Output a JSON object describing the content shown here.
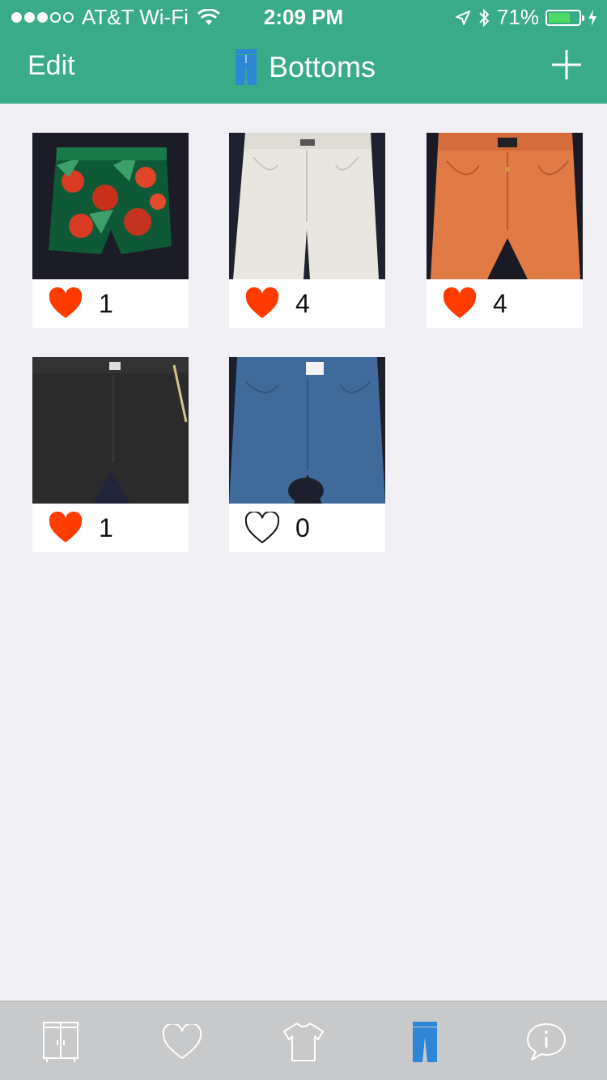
{
  "status_bar": {
    "carrier": "AT&T Wi-Fi",
    "time": "2:09 PM",
    "battery": "71%",
    "battery_level": 0.71,
    "signal_bars_filled": 3,
    "signal_bars_total": 5
  },
  "nav": {
    "edit_label": "Edit",
    "title": "Bottoms",
    "add_icon": "plus-icon",
    "title_icon": "pants-icon"
  },
  "colors": {
    "header": "#3aab88",
    "heart": "#ff3b00",
    "tab_active": "#2e86d6",
    "background": "#efeff4",
    "tabbar": "#c8c9cb"
  },
  "items": [
    {
      "name": "floral shorts",
      "likes": "1",
      "liked": true
    },
    {
      "name": "white jeans",
      "likes": "4",
      "liked": true
    },
    {
      "name": "orange jeans",
      "likes": "4",
      "liked": true
    },
    {
      "name": "black pants",
      "likes": "1",
      "liked": true
    },
    {
      "name": "blue jeggings",
      "likes": "0",
      "liked": false
    }
  ],
  "tabs": [
    {
      "icon": "wardrobe-icon",
      "active": false
    },
    {
      "icon": "heart-icon",
      "active": false
    },
    {
      "icon": "shirt-icon",
      "active": false
    },
    {
      "icon": "pants-icon",
      "active": true
    },
    {
      "icon": "info-bubble-icon",
      "active": false
    }
  ]
}
